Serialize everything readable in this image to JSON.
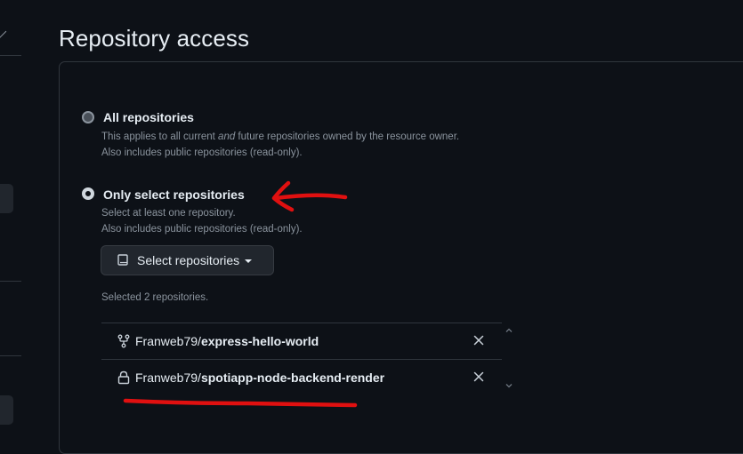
{
  "page": {
    "title": "Repository access"
  },
  "options": [
    {
      "label": "All repositories",
      "desc_line1_before": "This applies to all current ",
      "desc_line1_em": "and",
      "desc_line1_after": " future repositories owned by the resource owner.",
      "desc_line2": "Also includes public repositories (read-only).",
      "checked": false
    },
    {
      "label": "Only select repositories",
      "desc_line1": "Select at least one repository.",
      "desc_line2": "Also includes public repositories (read-only).",
      "checked": true
    }
  ],
  "select_button": {
    "label": "Select repositories",
    "icon": "repo-icon"
  },
  "selected_count": "Selected 2 repositories.",
  "repositories": [
    {
      "owner": "Franweb79/",
      "name": "express-hello-world",
      "icon": "repo-forked-icon"
    },
    {
      "owner": "Franweb79/",
      "name": "spotiapp-node-backend-render",
      "icon": "lock-icon"
    }
  ],
  "colors": {
    "background": "#0d1117",
    "border": "#30363d",
    "text": "#e6edf3",
    "muted": "#8b949e",
    "annotation": "#e01010"
  }
}
